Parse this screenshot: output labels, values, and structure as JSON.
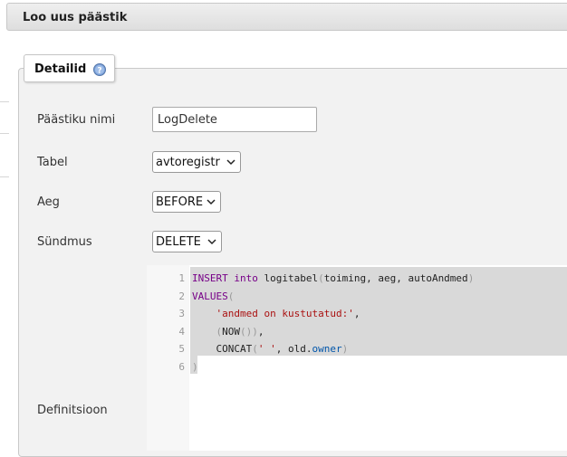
{
  "header": {
    "title": "Loo uus päästik"
  },
  "legend": {
    "label": "Detailid",
    "help_icon": "help-icon"
  },
  "form": {
    "name_label": "Päästiku nimi",
    "name_value": "LogDelete",
    "table_label": "Tabel",
    "table_value": "avtoregistr",
    "time_label": "Aeg",
    "time_value": "BEFORE",
    "event_label": "Sündmus",
    "event_value": "DELETE",
    "definition_label": "Definitsioon"
  },
  "editor": {
    "line_numbers": [
      "1",
      "2",
      "3",
      "4",
      "5",
      "6"
    ],
    "lines": [
      [
        {
          "t": "INSERT",
          "c": "kw"
        },
        {
          "t": " "
        },
        {
          "t": "into",
          "c": "kw"
        },
        {
          "t": " logitabel"
        },
        {
          "t": "(",
          "c": "punc"
        },
        {
          "t": "toiming, aeg, autoAndmed"
        },
        {
          "t": ")",
          "c": "punc"
        }
      ],
      [
        {
          "t": "VALUES",
          "c": "kw"
        },
        {
          "t": "(",
          "c": "punc"
        }
      ],
      [
        {
          "t": "    "
        },
        {
          "t": "'andmed on kustutatud:'",
          "c": "str"
        },
        {
          "t": ","
        }
      ],
      [
        {
          "t": "    "
        },
        {
          "t": "(",
          "c": "punc"
        },
        {
          "t": "NOW"
        },
        {
          "t": "())",
          "c": "punc"
        },
        {
          "t": ","
        }
      ],
      [
        {
          "t": "    CONCAT"
        },
        {
          "t": "(",
          "c": "punc"
        },
        {
          "t": "' '",
          "c": "str"
        },
        {
          "t": ", old."
        },
        {
          "t": "owner",
          "c": "prop"
        },
        {
          "t": ")",
          "c": "punc"
        }
      ],
      [
        {
          "t": ")",
          "c": "punc"
        }
      ]
    ]
  },
  "colors": {
    "keyword": "#770088",
    "string": "#aa1111",
    "property": "#0055aa",
    "selection": "#d9d9d9"
  }
}
